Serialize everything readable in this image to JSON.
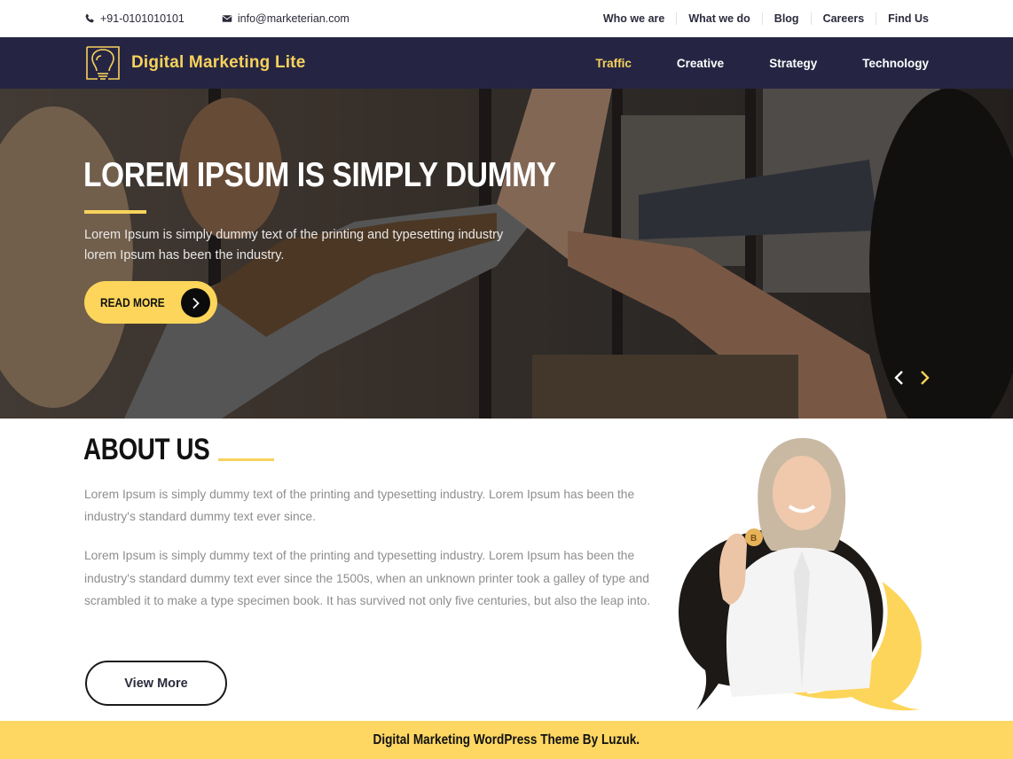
{
  "topbar": {
    "phone": "+91-0101010101",
    "email": "info@marketerian.com",
    "links": [
      "Who we are",
      "What we do",
      "Blog",
      "Careers",
      "Find Us"
    ]
  },
  "navbar": {
    "brand": "Digital Marketing Lite",
    "items": [
      {
        "label": "Traffic",
        "active": true
      },
      {
        "label": "Creative",
        "active": false
      },
      {
        "label": "Strategy",
        "active": false
      },
      {
        "label": "Technology",
        "active": false
      }
    ]
  },
  "hero": {
    "title": "LOREM IPSUM IS SIMPLY DUMMY",
    "text": "Lorem Ipsum is simply dummy text of the printing and typesetting industry lorem Ipsum has been the industry.",
    "button_label": "READ MORE"
  },
  "about": {
    "title": "ABOUT US",
    "paragraph1": "Lorem Ipsum is simply dummy text of the printing and typesetting industry. Lorem Ipsum has been the industry's standard dummy text ever since.",
    "paragraph2": "Lorem Ipsum is simply dummy text of the printing and typesetting industry. Lorem Ipsum has been the industry's standard dummy text ever since the 1500s, when an unknown printer took a galley of type and scrambled it to make a type specimen book. It has survived not only five centuries, but also the leap into.",
    "button_label": "View More"
  },
  "footer": {
    "credit": "Digital Marketing WordPress Theme By Luzuk."
  },
  "colors": {
    "accent": "#fcd55a",
    "nav_bg": "#252543",
    "text_dark": "#2b2b3d",
    "text_muted": "#8e8e8e"
  }
}
